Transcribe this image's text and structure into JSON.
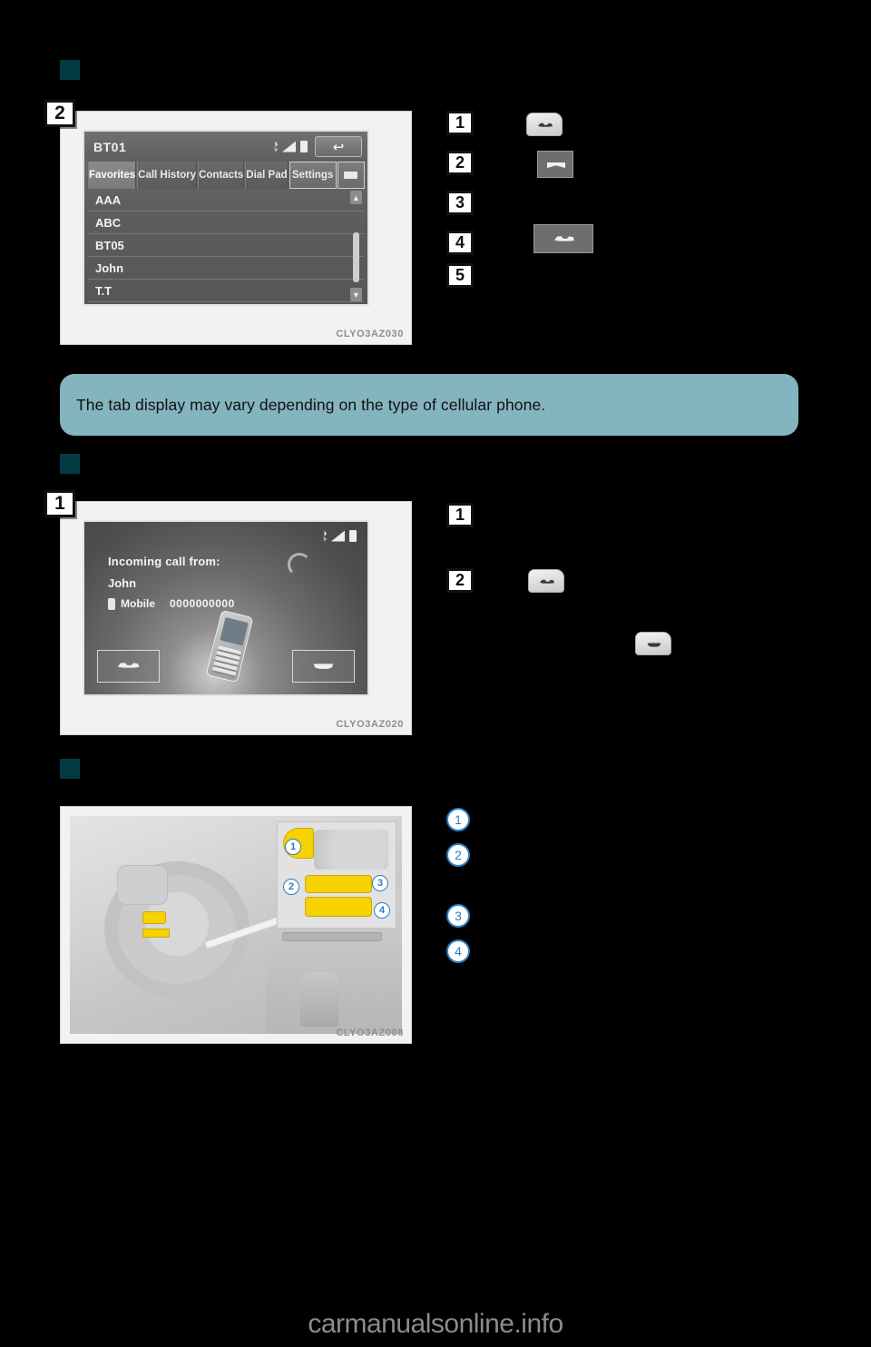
{
  "page": {
    "background": "#000000",
    "watermark": "carmanualsonline.info"
  },
  "sections": [
    {
      "id": "section-1",
      "heading": "",
      "figure": {
        "badge": "2",
        "code": "CLYO3AZ030",
        "screen": {
          "title": "BT01",
          "status_icons": [
            "bluetooth-icon",
            "signal-strength-icon",
            "battery-icon"
          ],
          "back_button": "↩",
          "tabs": [
            {
              "label": "Favorites",
              "active": true
            },
            {
              "label": "Call History",
              "active": false
            },
            {
              "label": "Contacts",
              "active": false
            },
            {
              "label": "Dial Pad",
              "active": false
            },
            {
              "label": "Settings",
              "active": false
            }
          ],
          "extra_tab_icon": "minimize-icon",
          "list_items": [
            "AAA",
            "ABC",
            "BT05",
            "John",
            "T.T"
          ],
          "scroll_up": "▲",
          "scroll_down": "▼"
        }
      },
      "callouts": [
        {
          "number": "1",
          "text": "",
          "icon": "steering-call-switch-icon"
        },
        {
          "number": "2",
          "text": "",
          "icon": "hangup-button-icon"
        },
        {
          "number": "3",
          "text": "",
          "icon": ""
        },
        {
          "number": "4",
          "text": "",
          "icon": "offhook-button-icon"
        },
        {
          "number": "5",
          "text": "",
          "icon": ""
        }
      ]
    },
    {
      "id": "section-2",
      "heading": "",
      "figure": {
        "badge": "1",
        "code": "CLYO3AZ020",
        "screen": {
          "status_icons": [
            "bluetooth-icon",
            "signal-strength-icon",
            "battery-icon"
          ],
          "incoming_label": "Incoming call from:",
          "caller_name": "John",
          "number_type": "Mobile",
          "phone_number": "0000000000",
          "answer_button": "answer-call-icon",
          "hangup_button": "end-call-icon"
        }
      },
      "callouts": [
        {
          "number": "1",
          "text": "",
          "icon": ""
        },
        {
          "number": "2",
          "text": "",
          "icon": "steering-call-switch-icon"
        },
        {
          "number": "extra",
          "text": "",
          "icon": "steering-hangup-switch-icon"
        }
      ]
    },
    {
      "id": "section-3",
      "heading": "",
      "figure": {
        "badge": "",
        "code": "CLYO3AZ008",
        "pins": [
          "1",
          "2",
          "3",
          "4"
        ]
      },
      "callouts": [
        {
          "number": "1",
          "text": ""
        },
        {
          "number": "2",
          "text": ""
        },
        {
          "number": "3",
          "text": ""
        },
        {
          "number": "4",
          "text": ""
        }
      ]
    }
  ],
  "note": {
    "text": "The tab display may vary depending on the type of cellular phone.",
    "background": "#84b4c0"
  }
}
